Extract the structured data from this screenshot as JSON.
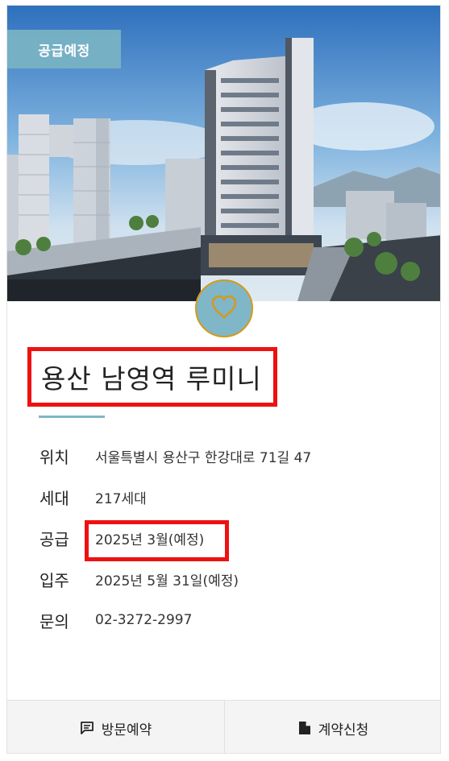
{
  "badge": "공급예정",
  "title": "용산 남영역 루미니",
  "info": [
    {
      "label": "위치",
      "value": "서울특별시 용산구 한강대로 71길 47"
    },
    {
      "label": "세대",
      "value": "217세대"
    },
    {
      "label": "공급",
      "value": "2025년 3월(예정)"
    },
    {
      "label": "입주",
      "value": "2025년 5월 31일(예정)"
    },
    {
      "label": "문의",
      "value": "02-3272-2997"
    }
  ],
  "footer": {
    "visit_label": "방문예약",
    "contract_label": "계약신청"
  },
  "icons": {
    "favorite": "heart-icon",
    "visit": "message-icon",
    "contract": "document-icon"
  },
  "colors": {
    "accent": "#7fb7c8",
    "highlight": "#ee1111",
    "heart_ring": "#d39a1b"
  }
}
